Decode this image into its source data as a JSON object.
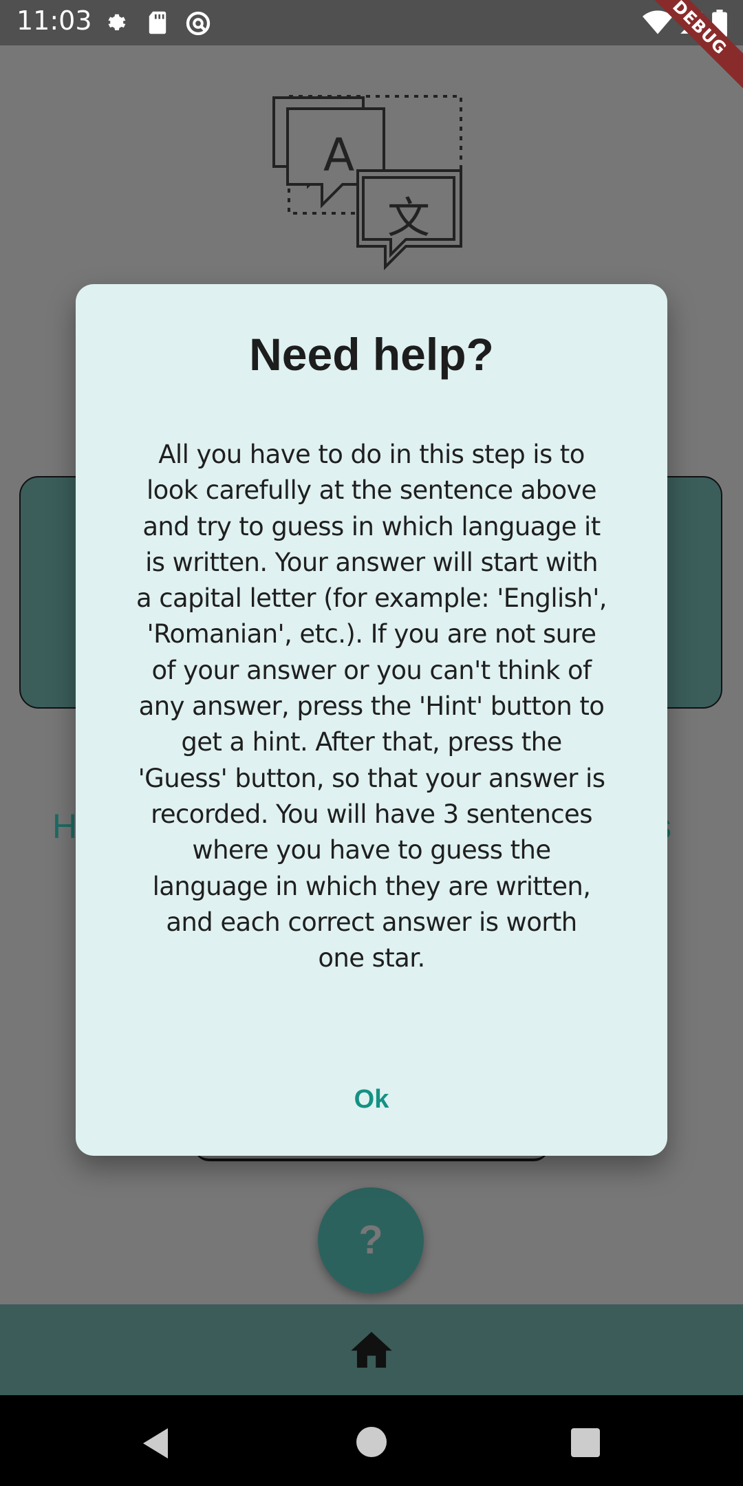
{
  "status_bar": {
    "time": "11:03",
    "icons": [
      "settings-icon",
      "sd-card-icon",
      "sync-icon",
      "wifi-icon",
      "signal-icon",
      "battery-icon"
    ],
    "debug_label": "DEBUG"
  },
  "background_app": {
    "logo_letters": [
      "A",
      "文"
    ],
    "hint_label": "H",
    "guess_label": "ss",
    "help_fab_label": "?",
    "bottom_nav_icon": "home-icon"
  },
  "dialog": {
    "title": "Need help?",
    "body_lines": [
      "All you have to do in this step is to",
      "look carefully at the sentence above",
      "and try to guess in which language it",
      "is written. Your answer will start with",
      "a capital letter (for example: 'English',",
      "'Romanian', etc.). If you are not sure",
      "of your answer or you can't think of",
      "any answer, press the 'Hint' button to",
      "get a hint. After that, press the",
      "'Guess' button, so that your answer is",
      "recorded. You will have 3 sentences",
      "where you have to guess the",
      "language in which they are written,",
      "and each correct answer is worth",
      "one star."
    ],
    "ok_label": "Ok"
  },
  "colors": {
    "dialog_bg": "#dff1f0",
    "accent": "#159185",
    "scrim": "#777777",
    "bottom_nav": "#3b5c59"
  }
}
